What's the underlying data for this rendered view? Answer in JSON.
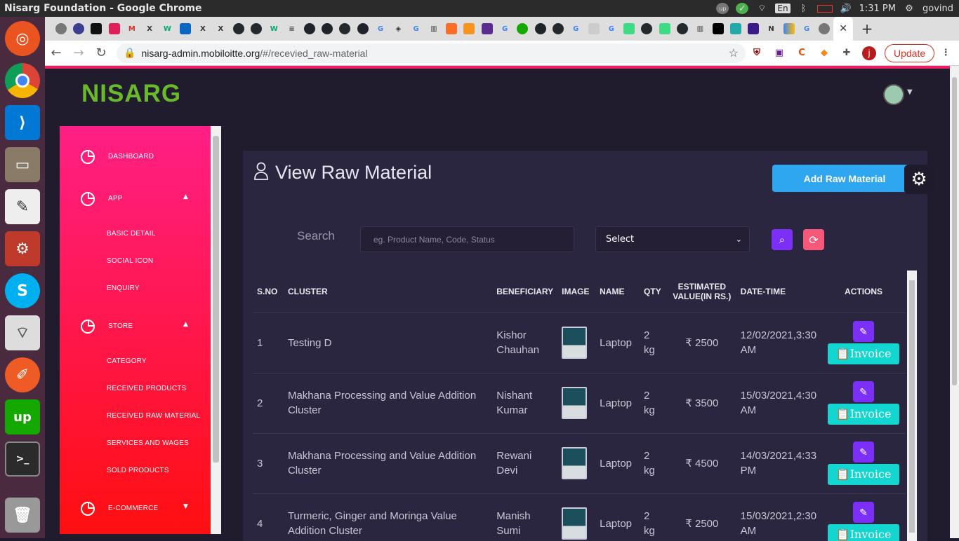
{
  "window": {
    "title": "Nisarg Foundation - Google Chrome"
  },
  "tray": {
    "keyboard": "En",
    "time": "1:31 PM",
    "user": "govind"
  },
  "browser": {
    "url_host": "nisarg-admin.mobiloitte.org",
    "url_path": "/#/recevied_raw-material",
    "update_label": "Update",
    "profile_initial": "j"
  },
  "app": {
    "logo": "NISARG"
  },
  "sidebar": {
    "dashboard": "DASHBOARD",
    "app": "APP",
    "basic_detail": "BASIC DETAIL",
    "social_icon": "SOCIAL ICON",
    "enquiry": "ENQUIRY",
    "store": "STORE",
    "category": "CATEGORY",
    "received_products": "RECEIVED PRODUCTS",
    "received_raw_material": "RECEIVED RAW MATERIAL",
    "services_and_wages": "SERVICES AND WAGES",
    "sold_products": "SOLD PRODUCTS",
    "ecommerce": "E-COMMERCE"
  },
  "main": {
    "title": "View Raw Material",
    "add_button": "Add Raw Material",
    "search_label": "Search",
    "search_placeholder": "eg. Product Name, Code, Status",
    "select_value": "Select"
  },
  "table": {
    "headers": {
      "sno": "S.NO",
      "cluster": "CLUSTER",
      "beneficiary": "BENEFICIARY",
      "image": "IMAGE",
      "name": "NAME",
      "qty": "QTY",
      "estimated_value": "ESTIMATED VALUE(IN RS.)",
      "datetime": "DATE-TIME",
      "actions": "ACTIONS"
    },
    "invoice_label": "Invoice",
    "rows": [
      {
        "sno": "1",
        "cluster": "Testing D",
        "beneficiary": "Kishor Chauhan",
        "name": "Laptop",
        "qty": "2 kg",
        "value": "₹ 2500",
        "datetime": "12/02/2021,3:30 AM"
      },
      {
        "sno": "2",
        "cluster": "Makhana Processing and Value Addition Cluster",
        "beneficiary": "Nishant Kumar",
        "name": "Laptop",
        "qty": "2 kg",
        "value": "₹ 3500",
        "datetime": "15/03/2021,4:30 AM"
      },
      {
        "sno": "3",
        "cluster": "Makhana Processing and Value Addition Cluster",
        "beneficiary": "Rewani Devi",
        "name": "Laptop",
        "qty": "2 kg",
        "value": "₹ 4500",
        "datetime": "14/03/2021,4:33 PM"
      },
      {
        "sno": "4",
        "cluster": "Turmeric, Ginger and Moringa Value Addition Cluster",
        "beneficiary": "Manish Sumi",
        "name": "Laptop",
        "qty": "2 kg",
        "value": "₹ 2500",
        "datetime": "15/03/2021,2:30 AM"
      }
    ]
  }
}
